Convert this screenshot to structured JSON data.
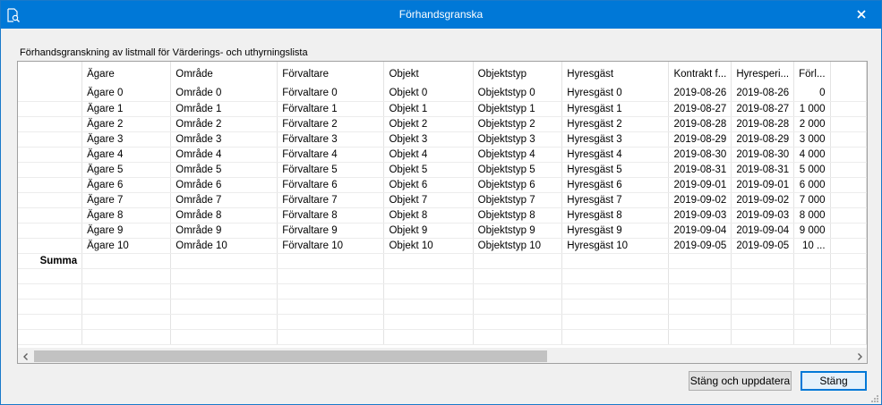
{
  "window": {
    "title": "Förhandsgranska"
  },
  "caption": "Förhandsgranskning av listmall för Värderings- och uthyrningslista",
  "grid": {
    "columns": [
      "",
      "Ägare",
      "Område",
      "Förvaltare",
      "Objekt",
      "Objektstyp",
      "Hyresgäst",
      "Kontrakt f...",
      "Hyresperi...",
      "Förl..."
    ],
    "rows": [
      [
        "Ägare 0",
        "Område 0",
        "Förvaltare 0",
        "Objekt 0",
        "Objektstyp 0",
        "Hyresgäst 0",
        "2019-08-26",
        "2019-08-26",
        "0"
      ],
      [
        "Ägare 1",
        "Område 1",
        "Förvaltare 1",
        "Objekt 1",
        "Objektstyp 1",
        "Hyresgäst 1",
        "2019-08-27",
        "2019-08-27",
        "1 000"
      ],
      [
        "Ägare 2",
        "Område 2",
        "Förvaltare 2",
        "Objekt 2",
        "Objektstyp 2",
        "Hyresgäst 2",
        "2019-08-28",
        "2019-08-28",
        "2 000"
      ],
      [
        "Ägare 3",
        "Område 3",
        "Förvaltare 3",
        "Objekt 3",
        "Objektstyp 3",
        "Hyresgäst 3",
        "2019-08-29",
        "2019-08-29",
        "3 000"
      ],
      [
        "Ägare 4",
        "Område 4",
        "Förvaltare 4",
        "Objekt 4",
        "Objektstyp 4",
        "Hyresgäst 4",
        "2019-08-30",
        "2019-08-30",
        "4 000"
      ],
      [
        "Ägare 5",
        "Område 5",
        "Förvaltare 5",
        "Objekt 5",
        "Objektstyp 5",
        "Hyresgäst 5",
        "2019-08-31",
        "2019-08-31",
        "5 000"
      ],
      [
        "Ägare 6",
        "Område 6",
        "Förvaltare 6",
        "Objekt 6",
        "Objektstyp 6",
        "Hyresgäst 6",
        "2019-09-01",
        "2019-09-01",
        "6 000"
      ],
      [
        "Ägare 7",
        "Område 7",
        "Förvaltare 7",
        "Objekt 7",
        "Objektstyp 7",
        "Hyresgäst 7",
        "2019-09-02",
        "2019-09-02",
        "7 000"
      ],
      [
        "Ägare 8",
        "Område 8",
        "Förvaltare 8",
        "Objekt 8",
        "Objektstyp 8",
        "Hyresgäst 8",
        "2019-09-03",
        "2019-09-03",
        "8 000"
      ],
      [
        "Ägare 9",
        "Område 9",
        "Förvaltare 9",
        "Objekt 9",
        "Objektstyp 9",
        "Hyresgäst 9",
        "2019-09-04",
        "2019-09-04",
        "9 000"
      ],
      [
        "Ägare 10",
        "Område 10",
        "Förvaltare 10",
        "Objekt 10",
        "Objektstyp 10",
        "Hyresgäst 10",
        "2019-09-05",
        "2019-09-05",
        "10 ..."
      ]
    ],
    "sum_label": "Summa",
    "empty_rows": 5
  },
  "buttons": {
    "update_close": "Stäng och uppdatera",
    "close": "Stäng"
  },
  "icons": {
    "app": "preview-document-icon",
    "close": "close-icon",
    "scroll_left": "chevron-left-icon",
    "scroll_right": "chevron-right-icon",
    "grip": "resize-grip-icon"
  },
  "colors": {
    "titlebar": "#0078d7",
    "primary_button_border": "#0078d7"
  }
}
